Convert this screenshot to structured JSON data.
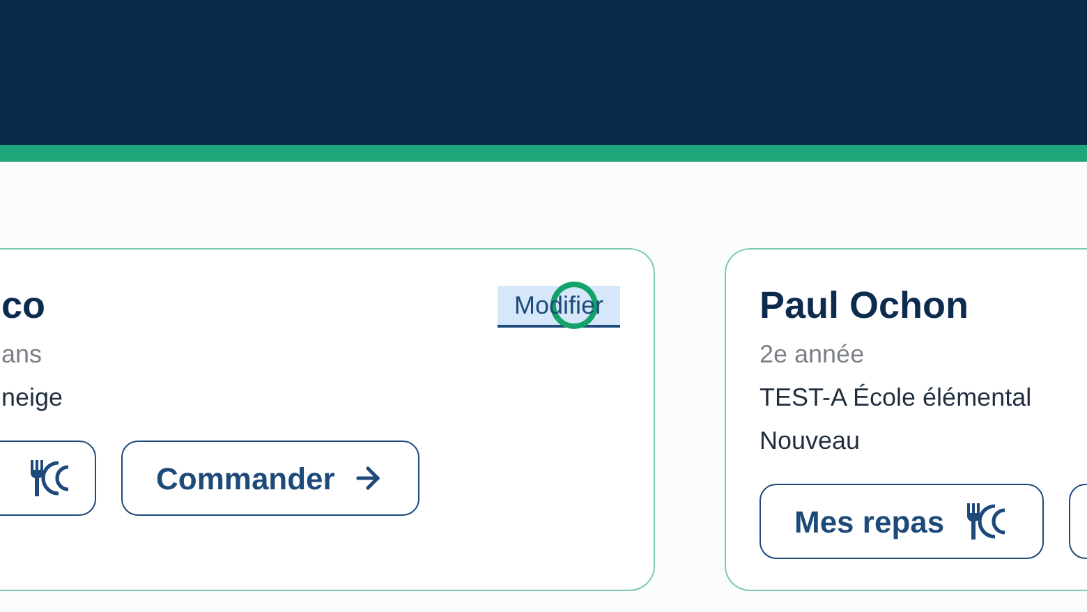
{
  "cards": [
    {
      "name": "co",
      "lines": [
        {
          "text": "ans",
          "kind": "muted"
        },
        {
          "text": "neige",
          "kind": "default"
        }
      ],
      "edit_link": "Modifier",
      "buttons": [
        {
          "kind": "meals"
        },
        {
          "kind": "order",
          "label": "Commander"
        }
      ]
    },
    {
      "name": "Paul Ochon",
      "lines": [
        {
          "text": "2e année",
          "kind": "muted"
        },
        {
          "text": "TEST-A École élémental",
          "kind": "default"
        },
        {
          "text": "Nouveau",
          "kind": "default"
        }
      ],
      "buttons": [
        {
          "kind": "meals",
          "label": "Mes repas"
        },
        {
          "kind": "order"
        }
      ]
    }
  ]
}
